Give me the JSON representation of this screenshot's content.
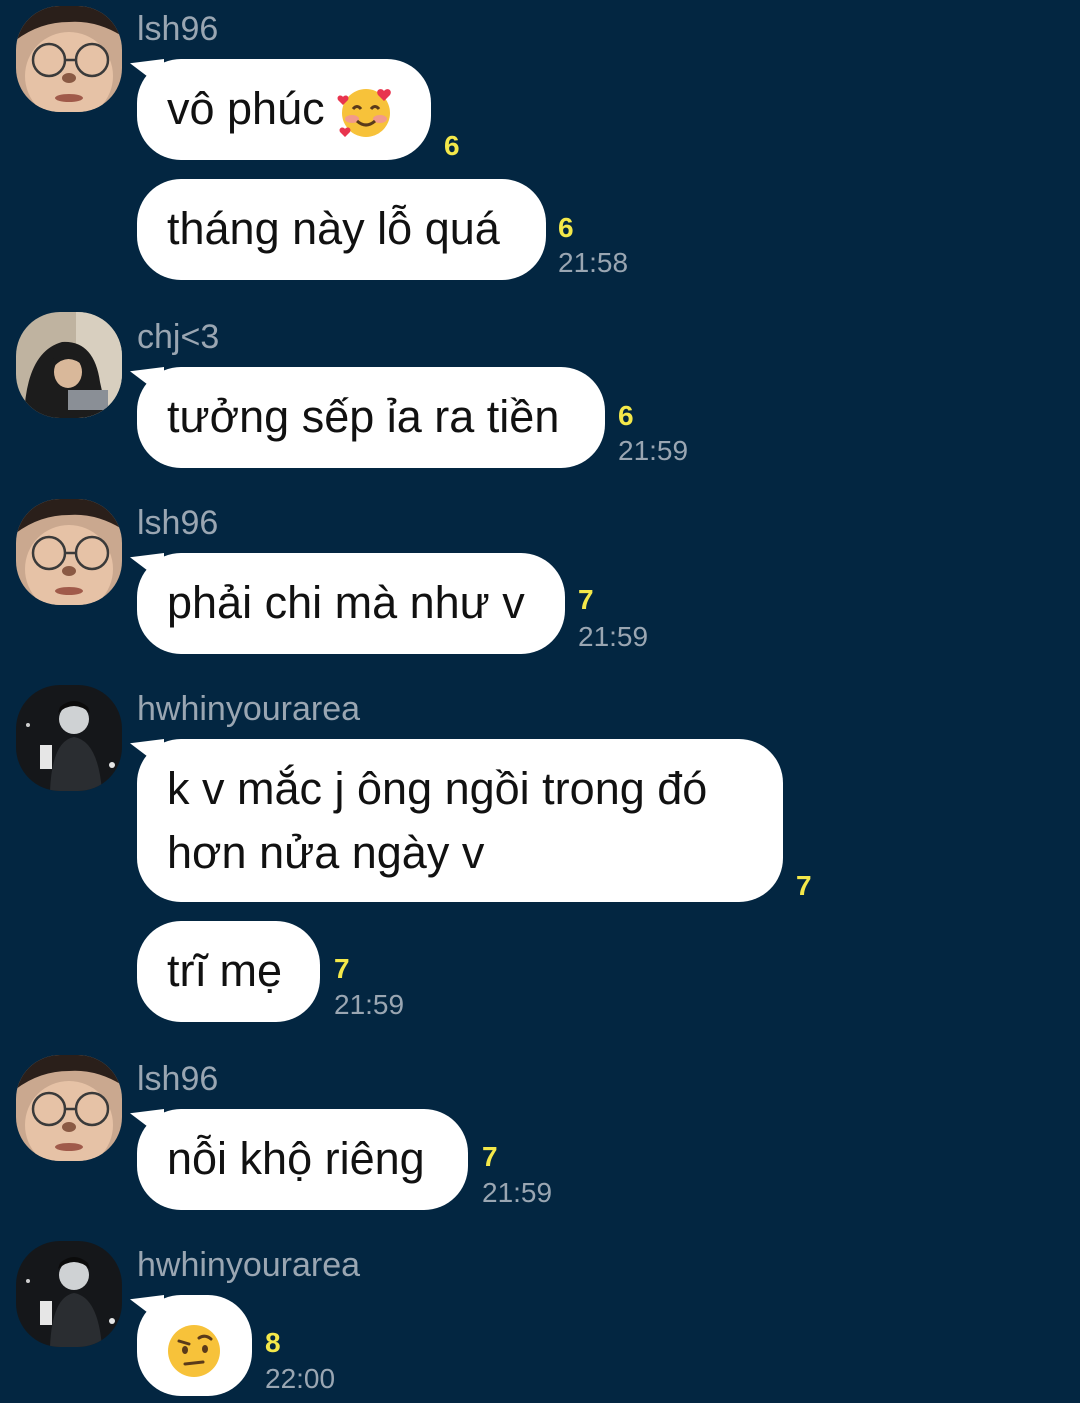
{
  "messages": [
    {
      "sender": "lsh96",
      "text": "vô phúc",
      "read": "6"
    },
    {
      "text": "tháng này lỗ quá",
      "read": "6",
      "time": "21:58"
    },
    {
      "sender": "chj<3",
      "text": "tưởng sếp ỉa ra tiền",
      "read": "6",
      "time": "21:59"
    },
    {
      "sender": "lsh96",
      "text": "phải chi mà như v",
      "read": "7",
      "time": "21:59"
    },
    {
      "sender": "hwhinyourarea",
      "lines": [
        "k v mắc j ông ngồi trong đó",
        "hơn nửa ngày v"
      ],
      "read": "7"
    },
    {
      "text": "trĩ mẹ",
      "read": "7",
      "time": "21:59"
    },
    {
      "sender": "lsh96",
      "text": "nỗi khộ riêng",
      "read": "7",
      "time": "21:59"
    },
    {
      "sender": "hwhinyourarea",
      "emoji": "raised-eyebrow-face",
      "read": "8",
      "time": "22:00"
    }
  ],
  "colors": {
    "background": "#032641",
    "bubble": "#ffffff",
    "read_count": "#f4e84a",
    "meta_text": "#9aa6b2"
  }
}
